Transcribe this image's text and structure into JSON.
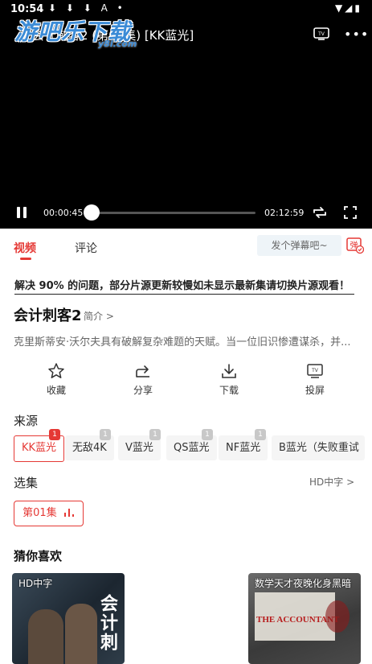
{
  "status_bar": {
    "time": "10:54",
    "icons": "⬇ ⬇ ⬇ A •",
    "right_icons": "▼◢▮"
  },
  "watermark": {
    "main": "游吧乐下载",
    "sub": "y8l.com"
  },
  "player": {
    "title": "会计刺客2 (第01集) [KK蓝光]",
    "current_time": "00:00:45",
    "total_time": "02:12:59",
    "progress": 0.0056
  },
  "tabs": {
    "video": "视频",
    "comments": "评论"
  },
  "danmu": {
    "placeholder": "发个弹幕吧~",
    "icon_label": "弹"
  },
  "notice": "解决 90% 的问题，部分片源更新较慢如未显示最新集请切换片源观看！",
  "movie": {
    "title": "会计刺客2",
    "intro_link": "简介 >",
    "description": "克里斯蒂安·沃尔夫具有破解复杂难题的天赋。当一位旧识惨遭谋杀，并..."
  },
  "actions": [
    {
      "label": "收藏",
      "icon": "star-icon"
    },
    {
      "label": "分享",
      "icon": "share-icon"
    },
    {
      "label": "下载",
      "icon": "download-icon"
    },
    {
      "label": "投屏",
      "icon": "tv-cast-icon"
    }
  ],
  "sources": {
    "label": "来源",
    "items": [
      {
        "name": "KK蓝光",
        "badge": "1"
      },
      {
        "name": "无敌4K",
        "badge": "1"
      },
      {
        "name": "V蓝光",
        "badge": "1"
      },
      {
        "name": "QS蓝光",
        "badge": "1"
      },
      {
        "name": "NF蓝光",
        "badge": "1"
      },
      {
        "name": "B蓝光（失败重试"
      }
    ]
  },
  "episodes": {
    "label": "选集",
    "quality_link": "HD中字 >",
    "items": [
      {
        "name": "第01集"
      }
    ]
  },
  "recommend": {
    "title": "猜你喜欢",
    "items": [
      {
        "tag": "HD中字",
        "poster_text": "会计刺"
      },
      {
        "tag": "数学天才夜晚化身黑暗",
        "poster_text": "THE ACCOUNTANT"
      }
    ]
  },
  "colors": {
    "accent": "#e53935",
    "player_bg": "#000000"
  }
}
